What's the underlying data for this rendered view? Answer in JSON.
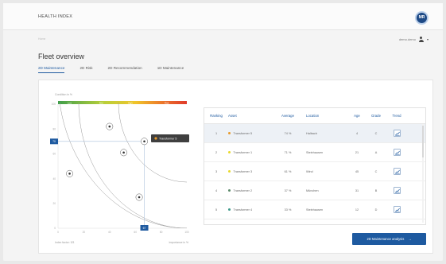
{
  "app": {
    "title": "HEALTH INDEX",
    "logo_text": "MR"
  },
  "breadcrumb": "Home",
  "user": {
    "name": "demo.demo"
  },
  "page": {
    "title": "Fleet overview"
  },
  "tabs": [
    {
      "label": "2D Maintenance",
      "active": true
    },
    {
      "label": "2D Risk",
      "active": false
    },
    {
      "label": "2D Recommendation",
      "active": false
    },
    {
      "label": "1D Maintenance",
      "active": false
    }
  ],
  "chart": {
    "ylabel": "Condition in %",
    "xlabel": "Importance in %",
    "footer": "Index factor: 3/3",
    "band_labels": [
      "Low",
      "Mid",
      "High",
      "Risk"
    ],
    "tooltip": "Transformer 5",
    "y_marker": "70",
    "x_marker": "67"
  },
  "chart_data": {
    "type": "scatter",
    "xlabel": "Importance in %",
    "ylabel": "Condition in %",
    "xlim": [
      0,
      100
    ],
    "ylim": [
      0,
      100
    ],
    "x_ticks": [
      "0",
      "20",
      "40",
      "60",
      "80",
      "100"
    ],
    "y_ticks": [
      "0",
      "20",
      "40",
      "60",
      "80",
      "100"
    ],
    "points": [
      {
        "x": 40,
        "y": 82
      },
      {
        "x": 67,
        "y": 70
      },
      {
        "x": 51,
        "y": 61
      },
      {
        "x": 9,
        "y": 44
      },
      {
        "x": 63,
        "y": 25
      }
    ],
    "markers": {
      "x": 67,
      "y": 70
    }
  },
  "table": {
    "headers": [
      "Ranking",
      "Asset",
      "Average",
      "Location",
      "Age",
      "Grade",
      "Trend"
    ],
    "rows": [
      {
        "rank": "1",
        "asset": "Transformer 5",
        "color": "#e79a2a",
        "avg": "74 %",
        "loc": "Halbach",
        "age": "4",
        "grade": "C",
        "highlight": true
      },
      {
        "rank": "2",
        "asset": "Transformer 1",
        "color": "#e7d92a",
        "avg": "71 %",
        "loc": "Steinhausen",
        "age": "21",
        "grade": "A",
        "highlight": false
      },
      {
        "rank": "3",
        "asset": "Transformer 3",
        "color": "#e7d92a",
        "avg": "61 %",
        "loc": "Wind",
        "age": "45",
        "grade": "C",
        "highlight": false
      },
      {
        "rank": "4",
        "asset": "Transformer 2",
        "color": "#5c8a6a",
        "avg": "37 %",
        "loc": "München",
        "age": "31",
        "grade": "B",
        "highlight": false
      },
      {
        "rank": "5",
        "asset": "Transformer 4",
        "color": "#3d9a8a",
        "avg": "33 %",
        "loc": "Steinhausen",
        "age": "12",
        "grade": "D",
        "highlight": false
      }
    ]
  },
  "actions": {
    "primary": "2D Maintenance analysis"
  }
}
